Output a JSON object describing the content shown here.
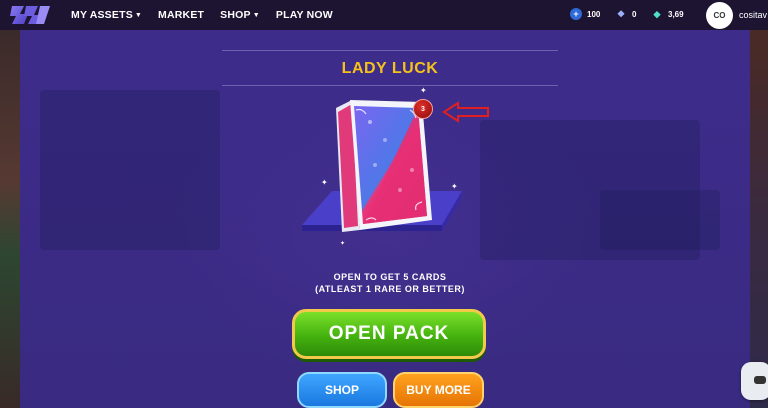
{
  "header": {
    "nav": [
      {
        "label": "MY ASSETS",
        "has_caret": true
      },
      {
        "label": "MARKET",
        "has_caret": false
      },
      {
        "label": "SHOP",
        "has_caret": true
      },
      {
        "label": "PLAY NOW",
        "has_caret": false
      }
    ],
    "stats": [
      {
        "icon": "plus-icon",
        "value": "100"
      },
      {
        "icon": "ticket-icon",
        "value": "0"
      },
      {
        "icon": "gem-icon",
        "value": "3,69"
      }
    ],
    "avatar_initials": "CO",
    "username": "cositav"
  },
  "pack": {
    "title": "LADY LUCK",
    "count_badge": "3",
    "desc_line1": "OPEN TO GET 5 CARDS",
    "desc_line2": "(ATLEAST 1 RARE OR BETTER)",
    "open_label": "OPEN PACK",
    "shop_label": "SHOP",
    "buy_more_label": "BUY MORE"
  },
  "colors": {
    "title": "#f6c21a",
    "open_button": "#45b20f",
    "shop_button": "#1a78e0",
    "buy_button": "#e67405",
    "annotation_arrow": "#e02020"
  }
}
